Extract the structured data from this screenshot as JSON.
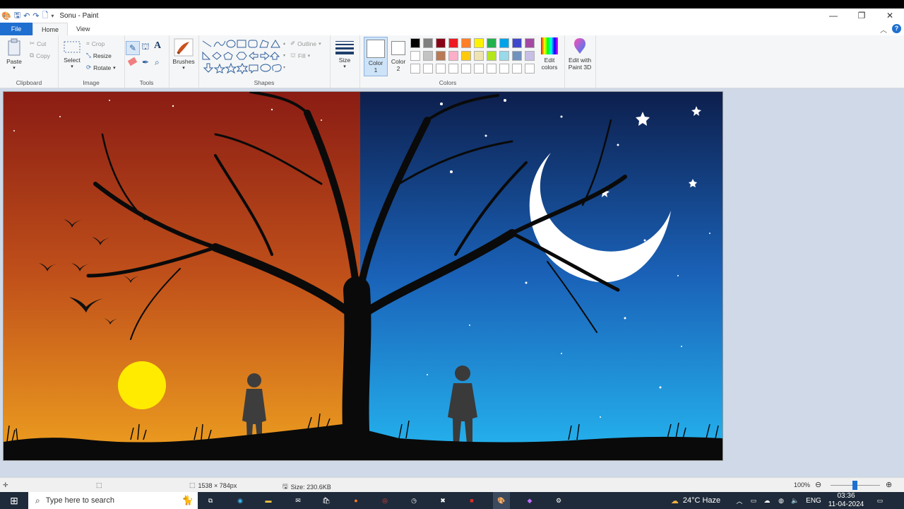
{
  "window": {
    "title": "Sonu  - Paint"
  },
  "tabs": [
    {
      "label": "File"
    },
    {
      "label": "Home"
    },
    {
      "label": "View"
    }
  ],
  "ribbon": {
    "clipboard": {
      "label": "Clipboard",
      "paste": "Paste",
      "cut": "Cut",
      "copy": "Copy"
    },
    "image": {
      "label": "Image",
      "select": "Select",
      "crop": "Crop",
      "resize": "Resize",
      "rotate": "Rotate"
    },
    "tools": {
      "label": "Tools"
    },
    "brushes": {
      "label": "Brushes"
    },
    "shapes": {
      "label": "Shapes",
      "outline": "Outline",
      "fill": "Fill"
    },
    "size": {
      "label": "Size"
    },
    "colors": {
      "label": "Colors",
      "color1": "Color",
      "color1_num": "1",
      "color2": "Color",
      "color2_num": "2",
      "edit_colors_1": "Edit",
      "edit_colors_2": "colors",
      "paint3d_1": "Edit with",
      "paint3d_2": "Paint 3D",
      "palette_row1": [
        "#000000",
        "#7f7f7f",
        "#880015",
        "#ed1c24",
        "#ff7f27",
        "#fff200",
        "#22b14c",
        "#00a2e8",
        "#3f48cc",
        "#a349a4"
      ],
      "palette_row2": [
        "#ffffff",
        "#c3c3c3",
        "#b97a57",
        "#ffaec9",
        "#ffc90e",
        "#efe4b0",
        "#b5e61d",
        "#99d9ea",
        "#7092be",
        "#c8bfe7"
      ],
      "color1_value": "#ffffff",
      "color2_value": "#ffffff"
    }
  },
  "status": {
    "dimensions": "1538 × 784px",
    "size": "Size: 230.6KB",
    "zoom": "100%"
  },
  "taskbar": {
    "search_placeholder": "Type here to search",
    "weather": "24°C  Haze",
    "language": "ENG",
    "time": "03:36",
    "date": "11-04-2024"
  }
}
